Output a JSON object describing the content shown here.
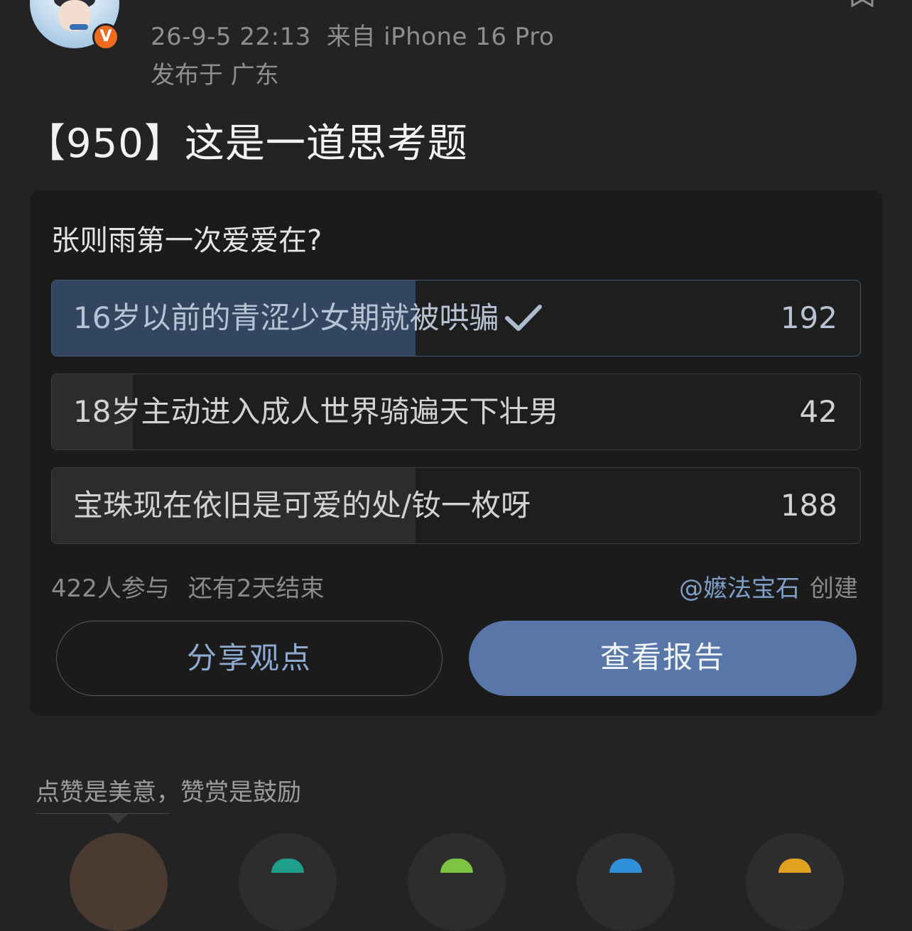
{
  "header": {
    "timestamp": "26-9-5 22:13",
    "source": "来自 iPhone 16 Pro",
    "location": "发布于 广东",
    "verified_badge": "V"
  },
  "post": {
    "title": "【950】这是一道思考题"
  },
  "poll": {
    "question": "张则雨第一次爱爱在?",
    "options": [
      {
        "label": "16岁以前的青涩少女期就被哄骗",
        "count": "192",
        "selected": true,
        "share": 0.45
      },
      {
        "label": "18岁主动进入成人世界骑遍天下壮男",
        "count": "42",
        "selected": false,
        "share": 0.1
      },
      {
        "label": "宝珠现在依旧是可爱的处/钕一枚呀",
        "count": "188",
        "selected": false,
        "share": 0.45
      }
    ],
    "participants": "422人参与",
    "remaining": "还有2天结束",
    "creator_handle": "@嬷法宝石",
    "creator_suffix": "创建",
    "share_button": "分享观点",
    "report_button": "查看报告"
  },
  "reward": {
    "text": "点赞是美意，赞赏是鼓励"
  },
  "colors": {
    "accent": "#5876a8",
    "selected_fill": "#33465f",
    "badge": "#ee6b1f",
    "background": "#232323"
  },
  "icons": [
    "avatar",
    "verified-badge-icon",
    "bookmark-icon",
    "check-icon"
  ]
}
